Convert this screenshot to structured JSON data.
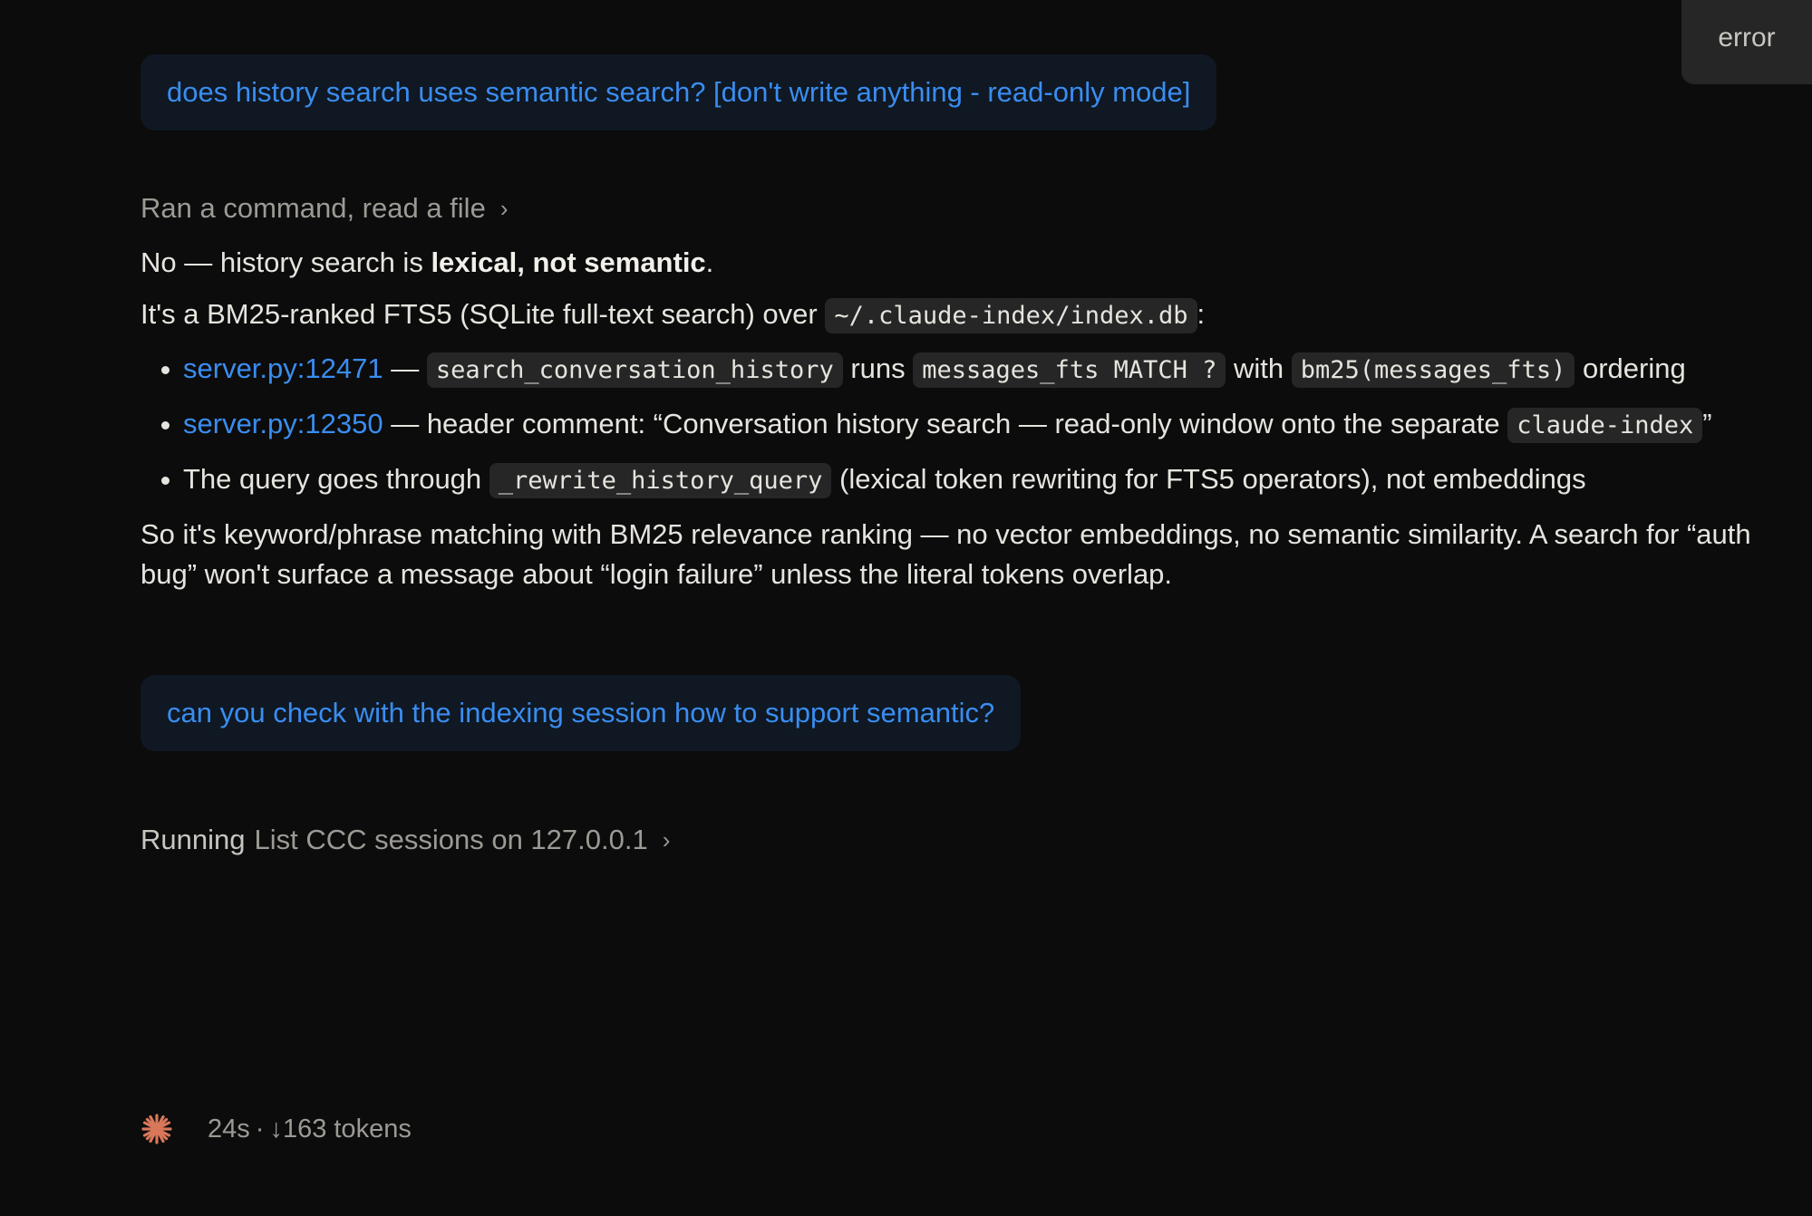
{
  "error_chip": "error",
  "conversation": {
    "user_message_1": "does history search uses semantic search? [don't write anything - read-only mode]",
    "tool_summary_1": "Ran a command, read a file",
    "answer": {
      "line1_prefix": "No — history search is ",
      "line1_bold": "lexical, not semantic",
      "line1_suffix": ".",
      "line2_prefix": "It's a BM25-ranked FTS5 (SQLite full-text search) over ",
      "line2_code": "~/.claude-index/index.db",
      "line2_suffix": ":",
      "bullet1": {
        "link": "server.py:12471",
        "dash": " — ",
        "code1": "search_conversation_history",
        "mid1": " runs ",
        "code2": "messages_fts MATCH ?",
        "mid2": " with ",
        "code3": "bm25(messages_fts)",
        "end": " ordering"
      },
      "bullet2": {
        "link": "server.py:12350",
        "text": " — header comment: “Conversation history search — read-only window onto the separate ",
        "code": "claude-index",
        "end": "”"
      },
      "bullet3": {
        "text": "The query goes through ",
        "code": "_rewrite_history_query",
        "end": " (lexical token rewriting for FTS5 operators), not embeddings"
      },
      "closing_line1": "So it's keyword/phrase matching with BM25 relevance ranking — no vector embeddings, no semantic similarity. A search for “auth",
      "closing_line2": "bug” won't surface a message about “login failure” unless the literal tokens overlap."
    },
    "user_message_2": "can you check with the indexing session how to support semantic?",
    "tool_running": {
      "label": "Running",
      "detail": "List CCC sessions on 127.0.0.1"
    }
  },
  "status": {
    "elapsed": "24s",
    "separator": "·",
    "arrow": "↓",
    "tokens": "163 tokens"
  },
  "colors": {
    "background": "#0c0c0c",
    "user_bubble": "#0f1823",
    "link_blue": "#3a8df0",
    "spark_orange": "#d9775a"
  }
}
